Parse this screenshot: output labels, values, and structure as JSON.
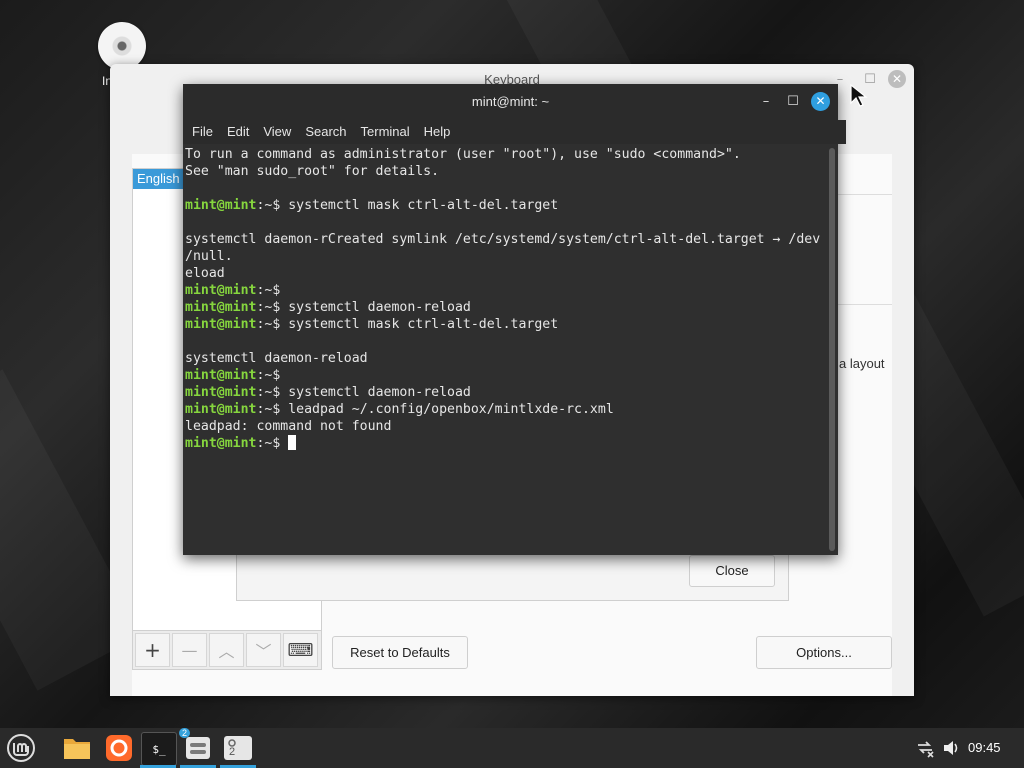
{
  "desktop": {
    "icon_label": "In"
  },
  "keyboard_window": {
    "title": "Keyboard",
    "layout_selected": "English",
    "side_text": "a layout",
    "reset_button": "Reset to Defaults",
    "options_button": "Options...",
    "toolbar": {
      "add": "+",
      "remove": "—",
      "up": "︿",
      "down": "﹀",
      "keyboard": "⌨"
    }
  },
  "dialog": {
    "close_button": "Close"
  },
  "terminal": {
    "title": "mint@mint: ~",
    "menu": [
      "File",
      "Edit",
      "View",
      "Search",
      "Terminal",
      "Help"
    ],
    "prompt_user": "mint@mint",
    "lines": [
      {
        "type": "text",
        "text": "To run a command as administrator (user \"root\"), use \"sudo <command>\"."
      },
      {
        "type": "text",
        "text": "See \"man sudo_root\" for details."
      },
      {
        "type": "text",
        "text": ""
      },
      {
        "type": "prompt",
        "path": ":~$ ",
        "cmd": "systemctl mask ctrl-alt-del.target"
      },
      {
        "type": "text",
        "text": ""
      },
      {
        "type": "text",
        "text": "systemctl daemon-rCreated symlink /etc/systemd/system/ctrl-alt-del.target → /dev"
      },
      {
        "type": "text",
        "text": "/null."
      },
      {
        "type": "text",
        "text": "eload"
      },
      {
        "type": "prompt",
        "path": ":~$",
        "cmd": ""
      },
      {
        "type": "prompt",
        "path": ":~$ ",
        "cmd": "systemctl daemon-reload"
      },
      {
        "type": "prompt",
        "path": ":~$ ",
        "cmd": "systemctl mask ctrl-alt-del.target"
      },
      {
        "type": "text",
        "text": ""
      },
      {
        "type": "text",
        "text": "systemctl daemon-reload"
      },
      {
        "type": "prompt",
        "path": ":~$",
        "cmd": ""
      },
      {
        "type": "prompt",
        "path": ":~$ ",
        "cmd": "systemctl daemon-reload"
      },
      {
        "type": "prompt",
        "path": ":~$ ",
        "cmd": "leadpad ~/.config/openbox/mintlxde-rc.xml"
      },
      {
        "type": "text",
        "text": "leadpad: command not found"
      },
      {
        "type": "prompt",
        "path": ":~$ ",
        "cmd": "",
        "cursor": true
      }
    ]
  },
  "taskbar": {
    "files_badge": "2",
    "workspace_label": "2",
    "clock": "09:45"
  },
  "colors": {
    "accent": "#35a2dc",
    "prompt_green": "#86d63e",
    "terminal_bg": "#2f2f2f"
  }
}
